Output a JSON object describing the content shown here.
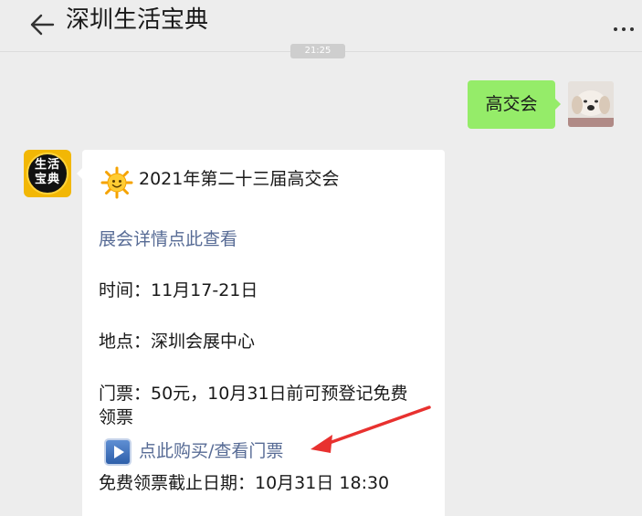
{
  "header": {
    "title": "深圳生活宝典",
    "back_icon": "arrow-left-icon",
    "more_icon": "ellipsis-icon"
  },
  "time_chip": {
    "text": "21:25"
  },
  "outgoing": {
    "text": "高交会",
    "bubble_color": "#95ec69"
  },
  "bot": {
    "avatar_text_line1": "生活",
    "avatar_text_line2": "宝典"
  },
  "message": {
    "title_icon": "sun-emoji-icon",
    "title": "2021年第二十三届高交会",
    "details_link": "展会详情点此查看",
    "time": "时间：11月17-21日",
    "place": "地点：深圳会展中心",
    "ticket_line1": "门票：50元，10月31日前可预登记免费",
    "ticket_line2": "领票",
    "buy_icon": "play-button-icon",
    "buy_link": "点此购买/查看门票",
    "deadline": "免费领票截止日期：10月31日 18:30",
    "link_color": "#576b95"
  },
  "annotation": {
    "arrow_color": "#e8312f"
  }
}
